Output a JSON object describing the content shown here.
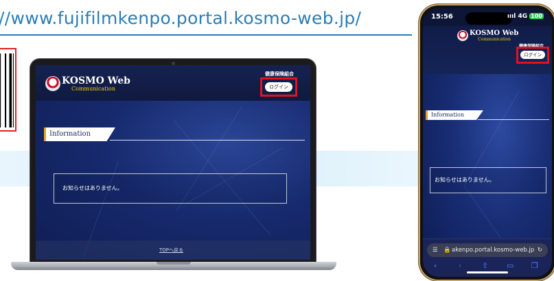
{
  "banner": {
    "url_text": "//www.fujifilmkenpo.portal.kosmo-web.jp/"
  },
  "colors": {
    "url_blue": "#2a7db6",
    "highlight_red": "#e3121d",
    "site_navy": "#152250",
    "accent_gold": "#e8a21a",
    "logo_yellow": "#f1d400"
  },
  "icons": {
    "qr": "qr-code-icon",
    "logo": "kosmo-logo-icon",
    "reader": "reader-mode-icon",
    "lock": "lock-icon",
    "reload": "reload-icon",
    "back": "chevron-left-icon",
    "forward": "chevron-right-icon",
    "share": "share-icon",
    "bookmarks": "book-icon",
    "tabs": "tabs-icon"
  },
  "site": {
    "logo_text": "KOSMO Web",
    "logo_subtext": "Communication",
    "union_name": "健康保険組合",
    "login_label": "ログイン",
    "info_heading": "Information",
    "notice_text": "お知らせはありません。",
    "top_link": "TOPへ戻る"
  },
  "phone": {
    "status_time": "15:56",
    "signal": "ıııl 4G",
    "battery": "100",
    "logo_text": "KOSMO Web",
    "logo_subtext": "Communication",
    "union_name": "健康保険組合",
    "login_label": "ログイン",
    "info_heading": "Information",
    "notice_text": "お知らせはありません。",
    "url_text": "akenpo.portal.kosmo-web.jp"
  }
}
